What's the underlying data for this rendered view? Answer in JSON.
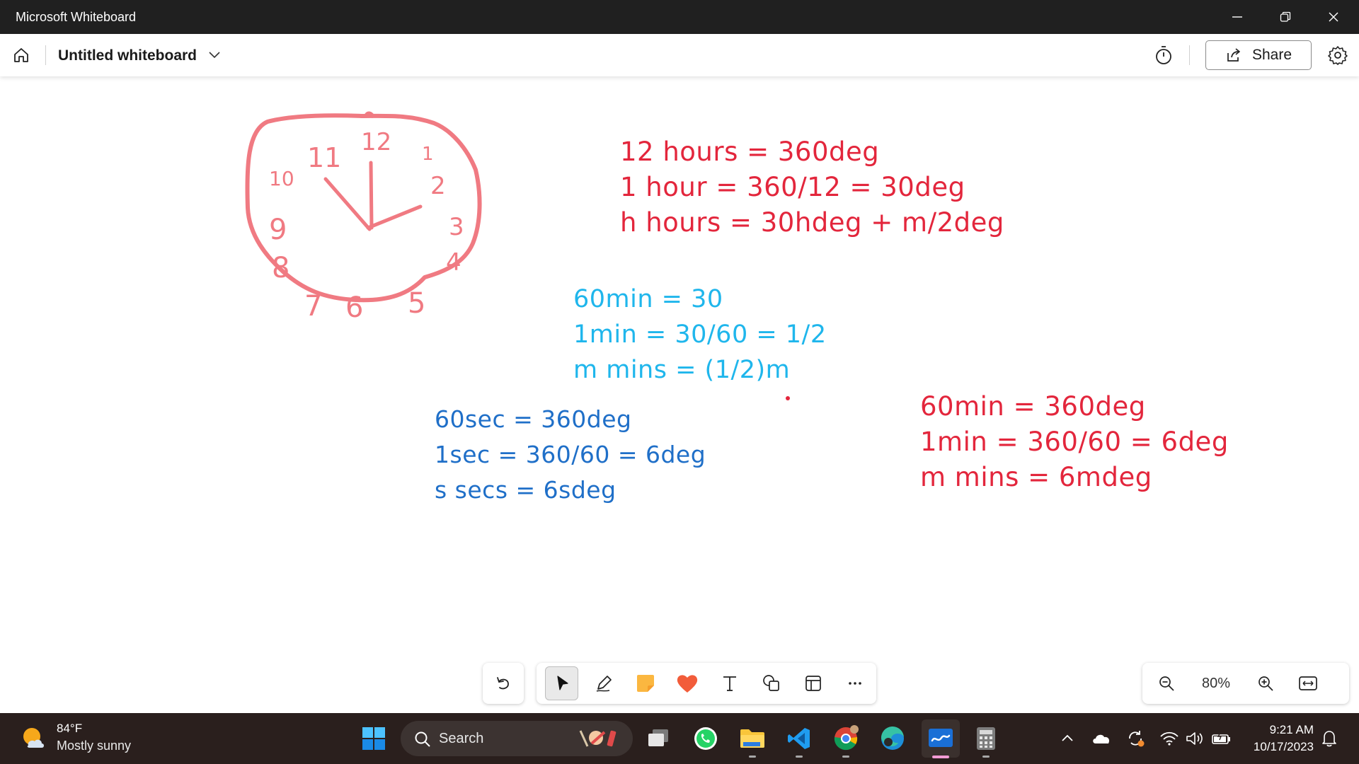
{
  "window": {
    "title": "Microsoft Whiteboard",
    "controls": [
      "minimize",
      "restore",
      "close"
    ]
  },
  "appbar": {
    "board_title": "Untitled whiteboard",
    "share_label": "Share"
  },
  "canvas": {
    "clock_numbers": [
      "12",
      "1",
      "2",
      "3",
      "4",
      "5",
      "6",
      "7",
      "8",
      "9",
      "10",
      "11"
    ],
    "ink_hours": [
      "12 hours = 360deg",
      "1 hour = 360/12 = 30deg",
      "h hours = 30hdeg + m/2deg"
    ],
    "ink_minutes_cyan": [
      "60min = 30",
      "1min = 30/60 = 1/2",
      "m mins = (1/2)m"
    ],
    "ink_seconds": [
      "60sec = 360deg",
      "1sec = 360/60 = 6deg",
      "s secs = 6sdeg"
    ],
    "ink_minutes_red": [
      "60min = 360deg",
      "1min = 360/60 = 6deg",
      "m mins = 6mdeg"
    ],
    "colors": {
      "red_ink": "#e3263c",
      "clock_ink": "#f07a82",
      "cyan_ink": "#1fb6ec",
      "blue_ink": "#1f6fc8"
    }
  },
  "toolbar": {
    "tools": [
      "undo-icon",
      "select-tool",
      "pen-tool",
      "sticky-note-tool",
      "reactions-tool",
      "text-tool",
      "shapes-tool",
      "templates-tool",
      "more-options"
    ],
    "zoom": "80%"
  },
  "taskbar": {
    "weather_temp": "84°F",
    "weather_desc": "Mostly sunny",
    "search_placeholder": "Search",
    "time": "9:21 AM",
    "date": "10/17/2023"
  }
}
